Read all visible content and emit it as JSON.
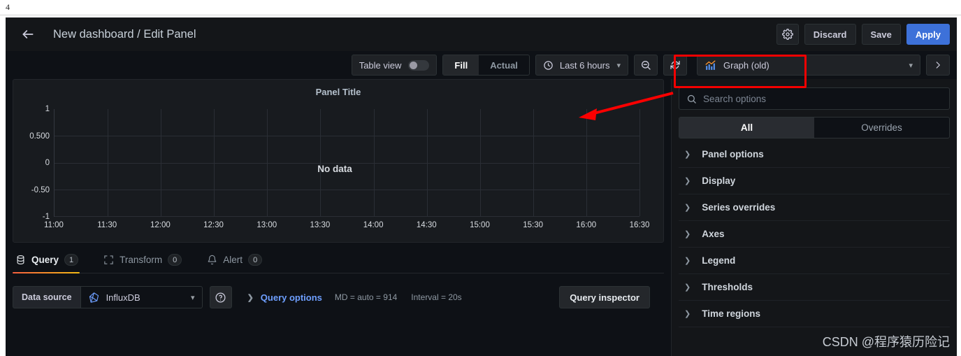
{
  "browser": {
    "tab_number": "4"
  },
  "header": {
    "back_icon": "back-arrow-icon",
    "title": "New dashboard / Edit Panel",
    "settings_icon": "gear-icon",
    "discard_label": "Discard",
    "save_label": "Save",
    "apply_label": "Apply",
    "apply_color": "#3d71d9"
  },
  "toolbar": {
    "table_view_label": "Table view",
    "table_view_on": false,
    "fill_label": "Fill",
    "actual_label": "Actual",
    "active_segment": "Fill",
    "time_range_label": "Last 6 hours",
    "clock_icon": "clock-icon",
    "zoom_out_icon": "zoom-out-icon",
    "refresh_icon": "refresh-icon",
    "chevron_icon": "chevron-down-icon"
  },
  "viz_picker": {
    "icon": "graph-bar-line-icon",
    "label": "Graph (old)",
    "chevron_icon": "chevron-down-icon",
    "expand_icon": "chevron-right-icon"
  },
  "panel": {
    "title": "Panel Title",
    "no_data_text": "No data"
  },
  "chart_data": {
    "type": "line",
    "title": "Panel Title",
    "xlabel": "",
    "ylabel": "",
    "grid": true,
    "legend": "none",
    "series": [],
    "empty_message": "No data",
    "x_tick_labels": [
      "11:00",
      "11:30",
      "12:00",
      "12:30",
      "13:00",
      "13:30",
      "14:00",
      "14:30",
      "15:00",
      "15:30",
      "16:00",
      "16:30"
    ],
    "y_tick_labels": [
      "1",
      "0.500",
      "0",
      "-0.50",
      "-1"
    ],
    "ylim": [
      -1,
      1
    ],
    "y_ticks": [
      1,
      0.5,
      0,
      -0.5,
      -1
    ]
  },
  "tabs": [
    {
      "label": "Query",
      "badge": "1",
      "icon": "database-icon",
      "active": true
    },
    {
      "label": "Transform",
      "badge": "0",
      "icon": "transform-icon",
      "active": false
    },
    {
      "label": "Alert",
      "badge": "0",
      "icon": "bell-icon",
      "active": false
    }
  ],
  "query": {
    "data_source_label": "Data source",
    "data_source_value": "InfluxDB",
    "data_source_icon": "influxdb-icon",
    "help_icon": "help-circle-icon",
    "query_options_label": "Query options",
    "query_options_caret": "chevron-right-icon",
    "max_data_points": "MD = auto = 914",
    "interval": "Interval = 20s",
    "query_inspector_label": "Query inspector"
  },
  "options_pane": {
    "search_placeholder": "Search options",
    "search_value": "",
    "search_icon": "search-icon",
    "tab_all": "All",
    "tab_overrides": "Overrides",
    "active_tab": "All",
    "sections": [
      {
        "label": "Panel options"
      },
      {
        "label": "Display"
      },
      {
        "label": "Series overrides"
      },
      {
        "label": "Axes"
      },
      {
        "label": "Legend"
      },
      {
        "label": "Thresholds"
      },
      {
        "label": "Time regions"
      }
    ]
  },
  "annotations": {
    "highlight_color": "#f40000",
    "arrow_color": "#fb0000"
  },
  "watermark": {
    "text": "CSDN @程序猿历险记"
  }
}
